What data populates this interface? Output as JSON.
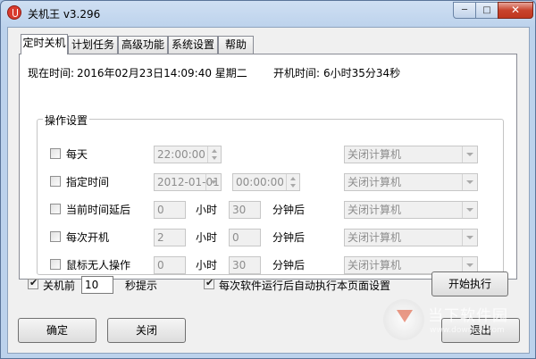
{
  "window": {
    "title": "关机王 v3.296",
    "controls": {
      "minimize": "─",
      "maximize": "□",
      "close": "✕"
    }
  },
  "tabs": [
    {
      "label": "定时关机",
      "active": true
    },
    {
      "label": "计划任务",
      "active": false
    },
    {
      "label": "高级功能",
      "active": false
    },
    {
      "label": "系统设置",
      "active": false
    },
    {
      "label": "帮助",
      "active": false
    }
  ],
  "status": {
    "current_time_label": "现在时间:",
    "current_time_value": "2016年02月23日14:09:40 星期二",
    "uptime_label": "开机时间:",
    "uptime_value": "6小时35分34秒"
  },
  "operations": {
    "title": "操作设置",
    "rows": [
      {
        "label": "每天",
        "checked": false,
        "time": "22:00:00",
        "action": "关闭计算机"
      },
      {
        "label": "指定时间",
        "checked": false,
        "date": "2012-01-01",
        "time": "00:00:00",
        "action": "关闭计算机"
      },
      {
        "label": "当前时间延后",
        "checked": false,
        "hours": "0",
        "hours_unit": "小时",
        "minutes": "30",
        "minutes_unit": "分钟后",
        "action": "关闭计算机"
      },
      {
        "label": "每次开机",
        "checked": false,
        "hours": "2",
        "hours_unit": "小时",
        "minutes": "0",
        "minutes_unit": "分钟后",
        "action": "关闭计算机"
      },
      {
        "label": "鼠标无人操作",
        "checked": false,
        "hours": "0",
        "hours_unit": "小时",
        "minutes": "30",
        "minutes_unit": "分钟后",
        "action": "关闭计算机"
      }
    ]
  },
  "bottom": {
    "prompt_label": "关机前",
    "prompt_checked": true,
    "prompt_seconds": "10",
    "prompt_suffix": "秒提示",
    "autorun_label": "每次软件运行后自动执行本页面设置",
    "autorun_checked": true,
    "start_button": "开始执行"
  },
  "footer": {
    "ok_button": "确定",
    "close_button": "关闭",
    "exit_button": "退出"
  },
  "watermark": {
    "text_cn": "当下软件园",
    "text_en": "www.downxia.com"
  },
  "colors": {
    "title_bar": "#bcd2ec",
    "close_button": "#c8432c",
    "panel": "#f0f0f0",
    "tab_content": "#ffffff"
  }
}
